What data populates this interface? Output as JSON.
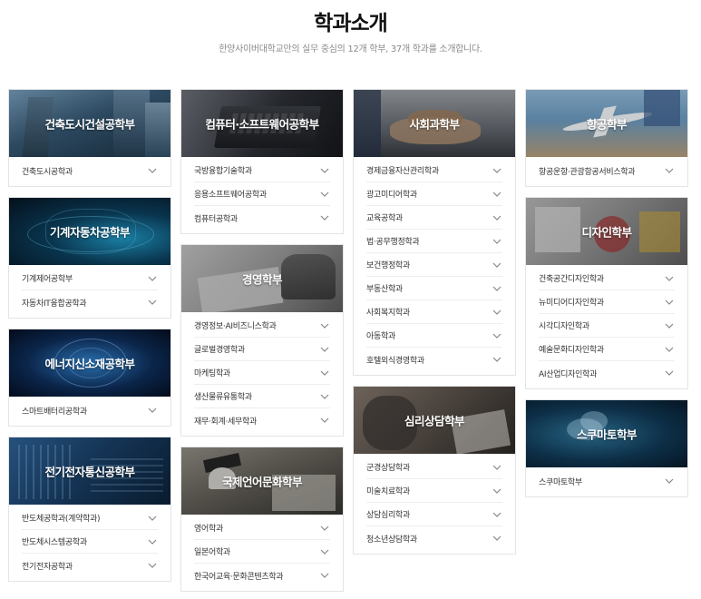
{
  "header": {
    "title": "학과소개",
    "subtitle": "한양사이버대학교만의 실무 중심의 12개 학부, 37개 학과를 소개합니다."
  },
  "columns": [
    {
      "cards": [
        {
          "title": "건축도시건설공학부",
          "majors": [
            "건축도시공학과"
          ]
        },
        {
          "title": "기계자동차공학부",
          "majors": [
            "기계제어공학부",
            "자동차IT융합공학과"
          ]
        },
        {
          "title": "에너지신소재공학부",
          "majors": [
            "스마트배터리공학과"
          ]
        },
        {
          "title": "전기전자통신공학부",
          "majors": [
            "반도체공학과(계약학과)",
            "반도체시스템공학과",
            "전기전자공학과"
          ]
        }
      ]
    },
    {
      "cards": [
        {
          "title": "컴퓨터·소프트웨어공학부",
          "majors": [
            "국방융합기술학과",
            "응용소프트웨어공학과",
            "컴퓨터공학과"
          ]
        },
        {
          "title": "경영학부",
          "majors": [
            "경영정보·AI비즈니스학과",
            "글로벌경영학과",
            "마케팅학과",
            "생산물류유통학과",
            "재무·회계·세무학과"
          ]
        },
        {
          "title": "국제언어문화학부",
          "majors": [
            "영어학과",
            "일본어학과",
            "한국어교육·문화콘텐츠학과"
          ]
        }
      ]
    },
    {
      "cards": [
        {
          "title": "사회과학부",
          "majors": [
            "경제금융자산관리학과",
            "광고미디어학과",
            "교육공학과",
            "법·공무행정학과",
            "보건행정학과",
            "부동산학과",
            "사회복지학과",
            "아동학과",
            "호텔외식경영학과"
          ]
        },
        {
          "title": "심리상담학부",
          "majors": [
            "군경상담학과",
            "미술치료학과",
            "상담심리학과",
            "청소년상담학과"
          ]
        }
      ]
    },
    {
      "cards": [
        {
          "title": "항공학부",
          "majors": [
            "항공운항·관광항공서비스학과"
          ]
        },
        {
          "title": "디자인학부",
          "majors": [
            "건축공간디자인학과",
            "뉴미디어디자인학과",
            "시각디자인학과",
            "예술문화디자인학과",
            "AI산업디자인학과"
          ]
        },
        {
          "title": "스쿠마토학부",
          "majors": [
            "스쿠마토학부"
          ]
        }
      ]
    }
  ],
  "colors": {
    "page_bg": "#ffffff",
    "card_border": "#e4e4e4",
    "list_divider": "#eeeeee",
    "banner_text": "#ffffff",
    "chevron": "#888888"
  },
  "icons": {
    "expand": "chevron-down-icon"
  }
}
